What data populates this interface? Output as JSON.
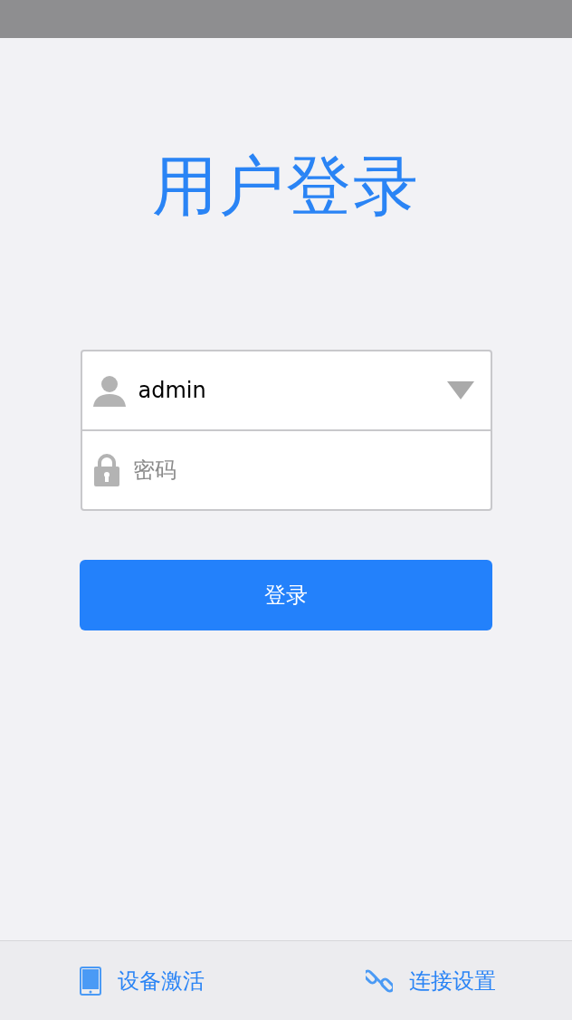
{
  "title": "用户登录",
  "username": {
    "value": "admin"
  },
  "password": {
    "placeholder": "密码"
  },
  "login_button": "登录",
  "bottom_links": [
    {
      "kind": "device",
      "label": "设备激活"
    },
    {
      "kind": "link",
      "label": "连接设置"
    }
  ]
}
